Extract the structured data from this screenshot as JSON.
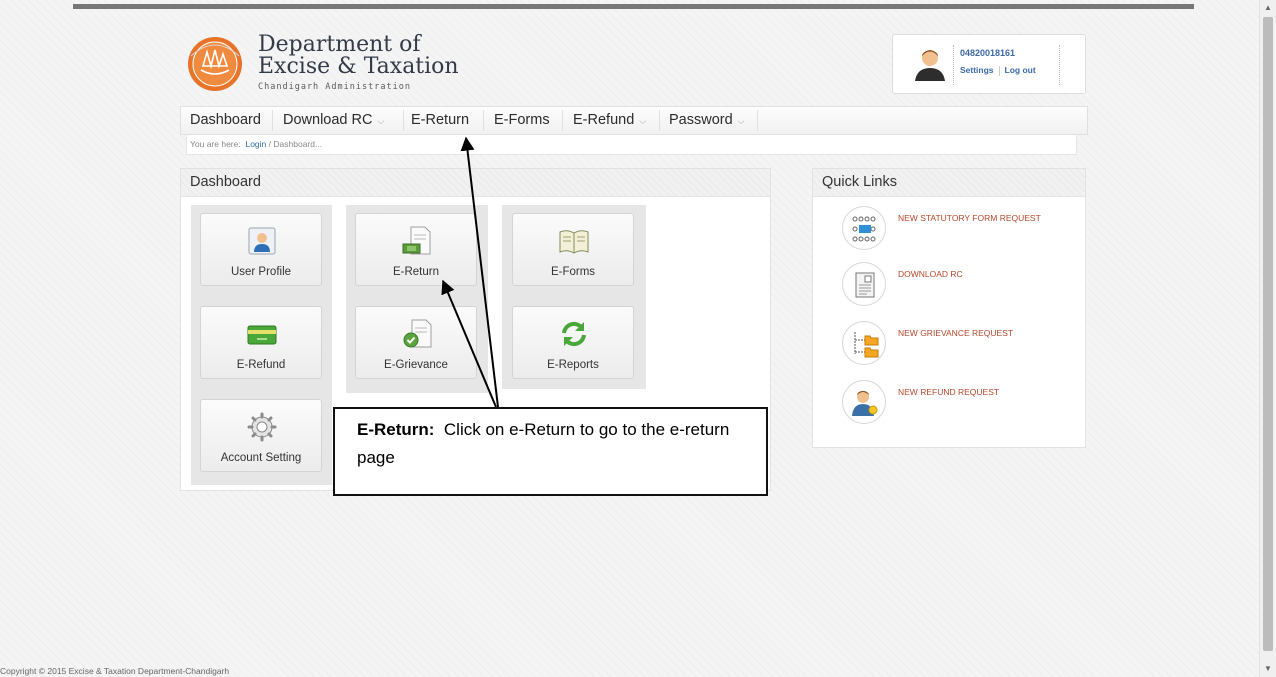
{
  "header": {
    "title_line1": "Department of",
    "title_line2": "Excise & Taxation",
    "subtitle": "Chandigarh Administration"
  },
  "user": {
    "id": "04820018161",
    "settings_label": "Settings",
    "logout_label": "Log out"
  },
  "nav": {
    "items": [
      {
        "label": "Dashboard",
        "dropdown": false
      },
      {
        "label": "Download RC",
        "dropdown": true
      },
      {
        "label": "E-Return",
        "dropdown": false
      },
      {
        "label": "E-Forms",
        "dropdown": false
      },
      {
        "label": "E-Refund",
        "dropdown": true
      },
      {
        "label": "Password",
        "dropdown": true
      }
    ]
  },
  "breadcrumb": {
    "prefix": "You are here:",
    "login": "Login",
    "separator": "/",
    "current": "Dashboard..."
  },
  "dashboard": {
    "title": "Dashboard",
    "tiles": [
      {
        "label": "User Profile",
        "icon": "user-profile-icon"
      },
      {
        "label": "E-Return",
        "icon": "e-return-icon"
      },
      {
        "label": "E-Forms",
        "icon": "e-forms-book-icon"
      },
      {
        "label": "E-Refund",
        "icon": "credit-card-icon"
      },
      {
        "label": "E-Grievance",
        "icon": "e-grievance-icon"
      },
      {
        "label": "E-Reports",
        "icon": "refresh-icon"
      },
      {
        "label": "Account Setting",
        "icon": "gear-icon"
      }
    ]
  },
  "quick_links": {
    "title": "Quick Links",
    "items": [
      {
        "label": "NEW STATUTORY FORM REQUEST",
        "icon": "statutory-form-icon"
      },
      {
        "label": "DOWNLOAD RC",
        "icon": "document-icon"
      },
      {
        "label": "NEW GRIEVANCE REQUEST",
        "icon": "folder-tree-icon"
      },
      {
        "label": "NEW REFUND REQUEST",
        "icon": "user-refund-icon"
      }
    ]
  },
  "callout": {
    "bold": "E-Return:",
    "text": "Click on e-Return to go to the e-return page"
  },
  "footer": "Copyright © 2015 Excise & Taxation Department-Chandigarh",
  "colors": {
    "link": "#2e6da4",
    "quick_link": "#b5482b",
    "user_link": "#3c6aa8",
    "logo_orange": "#e8742a"
  }
}
